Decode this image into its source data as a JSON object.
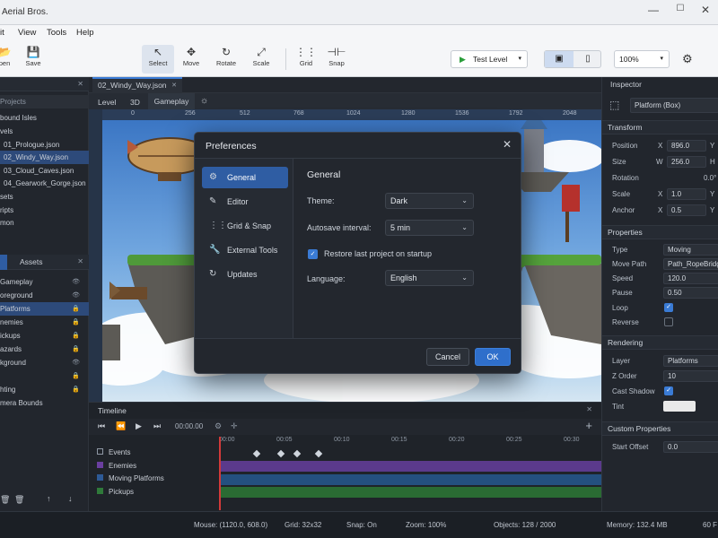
{
  "window": {
    "title": "Aerial Bros.",
    "minimize": "—",
    "maximize": "☐",
    "close": "✕"
  },
  "menu": [
    "it",
    "View",
    "Tools",
    "Help"
  ],
  "toolbar": {
    "open": "pen",
    "save": "Save",
    "tools": [
      {
        "label": "Select",
        "icon": "↖",
        "active": true
      },
      {
        "label": "Move",
        "icon": "✥"
      },
      {
        "label": "Rotate",
        "icon": "↻"
      },
      {
        "label": "Scale",
        "icon": "⤢"
      },
      {
        "label": "Grid",
        "icon": "⋮⋮"
      },
      {
        "label": "Snap",
        "icon": "⊣⊢"
      }
    ],
    "test_level": "Test Level",
    "zoom": "100%"
  },
  "left_panel": {
    "projects_header": "Projects",
    "tree": [
      {
        "label": "bound Isles",
        "indent": 0
      },
      {
        "label": "vels",
        "indent": 0
      },
      {
        "label": "01_Prologue.json",
        "indent": 1
      },
      {
        "label": "02_Windy_Way.json",
        "indent": 1,
        "selected": true
      },
      {
        "label": "03_Cloud_Caves.json",
        "indent": 1
      },
      {
        "label": "04_Gearwork_Gorge.json",
        "indent": 1
      },
      {
        "label": "sets",
        "indent": 0
      },
      {
        "label": "ripts",
        "indent": 0
      },
      {
        "label": "mon",
        "indent": 0
      }
    ],
    "assets_tab": "Assets",
    "layers": [
      {
        "label": "Gameplay",
        "icon": "👁"
      },
      {
        "label": "oreground",
        "icon": "👁"
      },
      {
        "label": "Platforms",
        "icon": "🔒",
        "selected": true
      },
      {
        "label": "nemies",
        "icon": "🔒"
      },
      {
        "label": "ickups",
        "icon": "🔒"
      },
      {
        "label": "azards",
        "icon": "🔒"
      },
      {
        "label": "kground",
        "icon": "👁"
      },
      {
        "label": "",
        "icon": "🔒"
      },
      {
        "label": "hting",
        "icon": "🔒"
      },
      {
        "label": "mera Bounds",
        "icon": ""
      }
    ]
  },
  "editor": {
    "file_tab": "02_Windy_Way.json",
    "subtabs": [
      "Level",
      "3D",
      "Gameplay"
    ],
    "ruler": [
      "0",
      "256",
      "512",
      "768",
      "1024",
      "1280",
      "1536",
      "1792",
      "2048"
    ]
  },
  "timeline": {
    "title": "Timeline",
    "time": "00:00.00",
    "ticks": [
      "00:00",
      "00:05",
      "00:10",
      "00:15",
      "00:20",
      "00:25",
      "00:30"
    ],
    "tracks": [
      {
        "label": "Events",
        "color": "#7a8594"
      },
      {
        "label": "Enemies",
        "color": "#6a3fa0"
      },
      {
        "label": "Moving Platforms",
        "color": "#2d5a96"
      },
      {
        "label": "Pickups",
        "color": "#2f7a3a"
      }
    ]
  },
  "inspector": {
    "title": "Inspector",
    "object": "Platform (Box)",
    "transform": "Transform",
    "position": {
      "label": "Position",
      "x": "896.0",
      "y": "Y"
    },
    "size": {
      "label": "Size",
      "w": "256.0",
      "h": "H"
    },
    "rotation": {
      "label": "Rotation",
      "value": "0.0°"
    },
    "scale": {
      "label": "Scale",
      "x": "1.0",
      "y": "Y"
    },
    "anchor": {
      "label": "Anchor",
      "x": "0.5",
      "y": "Y"
    },
    "properties": "Properties",
    "type": {
      "label": "Type",
      "value": "Moving"
    },
    "move_path": {
      "label": "Move Path",
      "value": "Path_RopeBridge"
    },
    "speed": {
      "label": "Speed",
      "value": "120.0"
    },
    "pause": {
      "label": "Pause",
      "value": "0.50"
    },
    "loop": {
      "label": "Loop"
    },
    "reverse": {
      "label": "Reverse"
    },
    "rendering": "Rendering",
    "layer": {
      "label": "Layer",
      "value": "Platforms"
    },
    "z_order": {
      "label": "Z Order",
      "value": "10"
    },
    "cast_shadow": {
      "label": "Cast Shadow"
    },
    "tint": {
      "label": "Tint"
    },
    "custom": "Custom Properties",
    "start_offset": {
      "label": "Start Offset",
      "value": "0.0"
    }
  },
  "status": {
    "mouse": "Mouse: (1120.0, 608.0)",
    "grid": "Grid: 32x32",
    "snap": "Snap: On",
    "zoom": "Zoom: 100%",
    "objects": "Objects: 128 / 2000",
    "memory": "Memory: 132.4 MB",
    "fps": "60 F"
  },
  "preferences": {
    "title": "Preferences",
    "nav": [
      {
        "label": "General",
        "icon": "⚙",
        "selected": true
      },
      {
        "label": "Editor",
        "icon": "✎"
      },
      {
        "label": "Grid & Snap",
        "icon": "⋮⋮"
      },
      {
        "label": "External Tools",
        "icon": "🔧"
      },
      {
        "label": "Updates",
        "icon": "↻"
      }
    ],
    "section": "General",
    "theme_label": "Theme:",
    "theme_value": "Dark",
    "autosave_label": "Autosave interval:",
    "autosave_value": "5 min",
    "restore_label": "Restore last project on startup",
    "language_label": "Language:",
    "language_value": "English",
    "cancel": "Cancel",
    "ok": "OK"
  }
}
